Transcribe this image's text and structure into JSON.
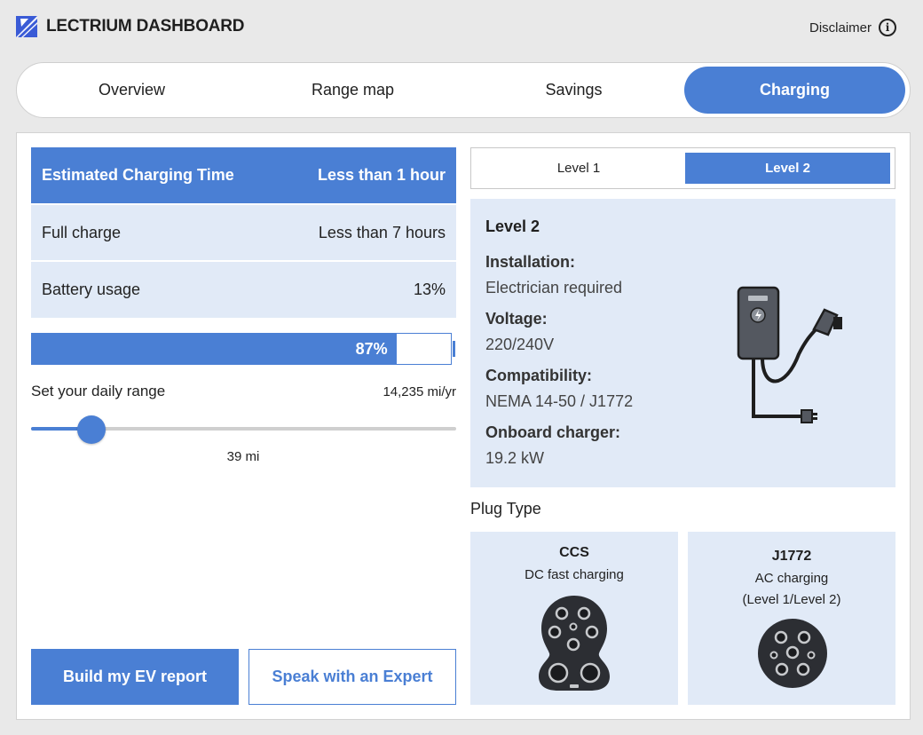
{
  "header": {
    "title": "LECTRIUM DASHBOARD",
    "disclaimer_label": "Disclaimer",
    "logo_icon": "lectrium-logo-icon",
    "info_icon": "info-icon"
  },
  "tabs": [
    {
      "label": "Overview",
      "active": false
    },
    {
      "label": "Range map",
      "active": false
    },
    {
      "label": "Savings",
      "active": false
    },
    {
      "label": "Charging",
      "active": true
    }
  ],
  "charging_summary": {
    "estimated": {
      "label": "Estimated Charging Time",
      "value": "Less than 1 hour"
    },
    "full_charge": {
      "label": "Full charge",
      "value": "Less than 7 hours"
    },
    "battery_usage": {
      "label": "Battery usage",
      "value": "13%"
    }
  },
  "battery_remaining": {
    "label": "87%",
    "fraction": 0.87
  },
  "daily_range": {
    "label": "Set your daily range",
    "annual": "14,235 mi/yr",
    "value_label": "39 mi",
    "fraction": 0.142
  },
  "buttons": {
    "build_report": "Build my EV report",
    "speak_expert": "Speak with an Expert"
  },
  "level_toggle": {
    "options": [
      "Level 1",
      "Level 2"
    ],
    "selected": "Level 2"
  },
  "level_info": {
    "title": "Level 2",
    "installation_label": "Installation:",
    "installation_value": "Electrician required",
    "voltage_label": "Voltage:",
    "voltage_value": "220/240V",
    "compatibility_label": "Compatibility:",
    "compatibility_value": "NEMA 14-50 / J1772",
    "onboard_label": "Onboard charger:",
    "onboard_value": "19.2 kW",
    "illustration_icon": "wall-charger-icon"
  },
  "plug_type": {
    "label": "Plug Type",
    "plugs": [
      {
        "name": "CCS",
        "desc": "DC fast charging",
        "icon": "ccs-plug-icon"
      },
      {
        "name": "J1772",
        "desc_line1": "AC charging",
        "desc_line2": "(Level 1/Level 2)",
        "icon": "j1772-plug-icon"
      }
    ]
  },
  "colors": {
    "accent": "#4a7fd4",
    "card_bg": "#e1eaf7",
    "page_bg": "#e9e9e9"
  }
}
